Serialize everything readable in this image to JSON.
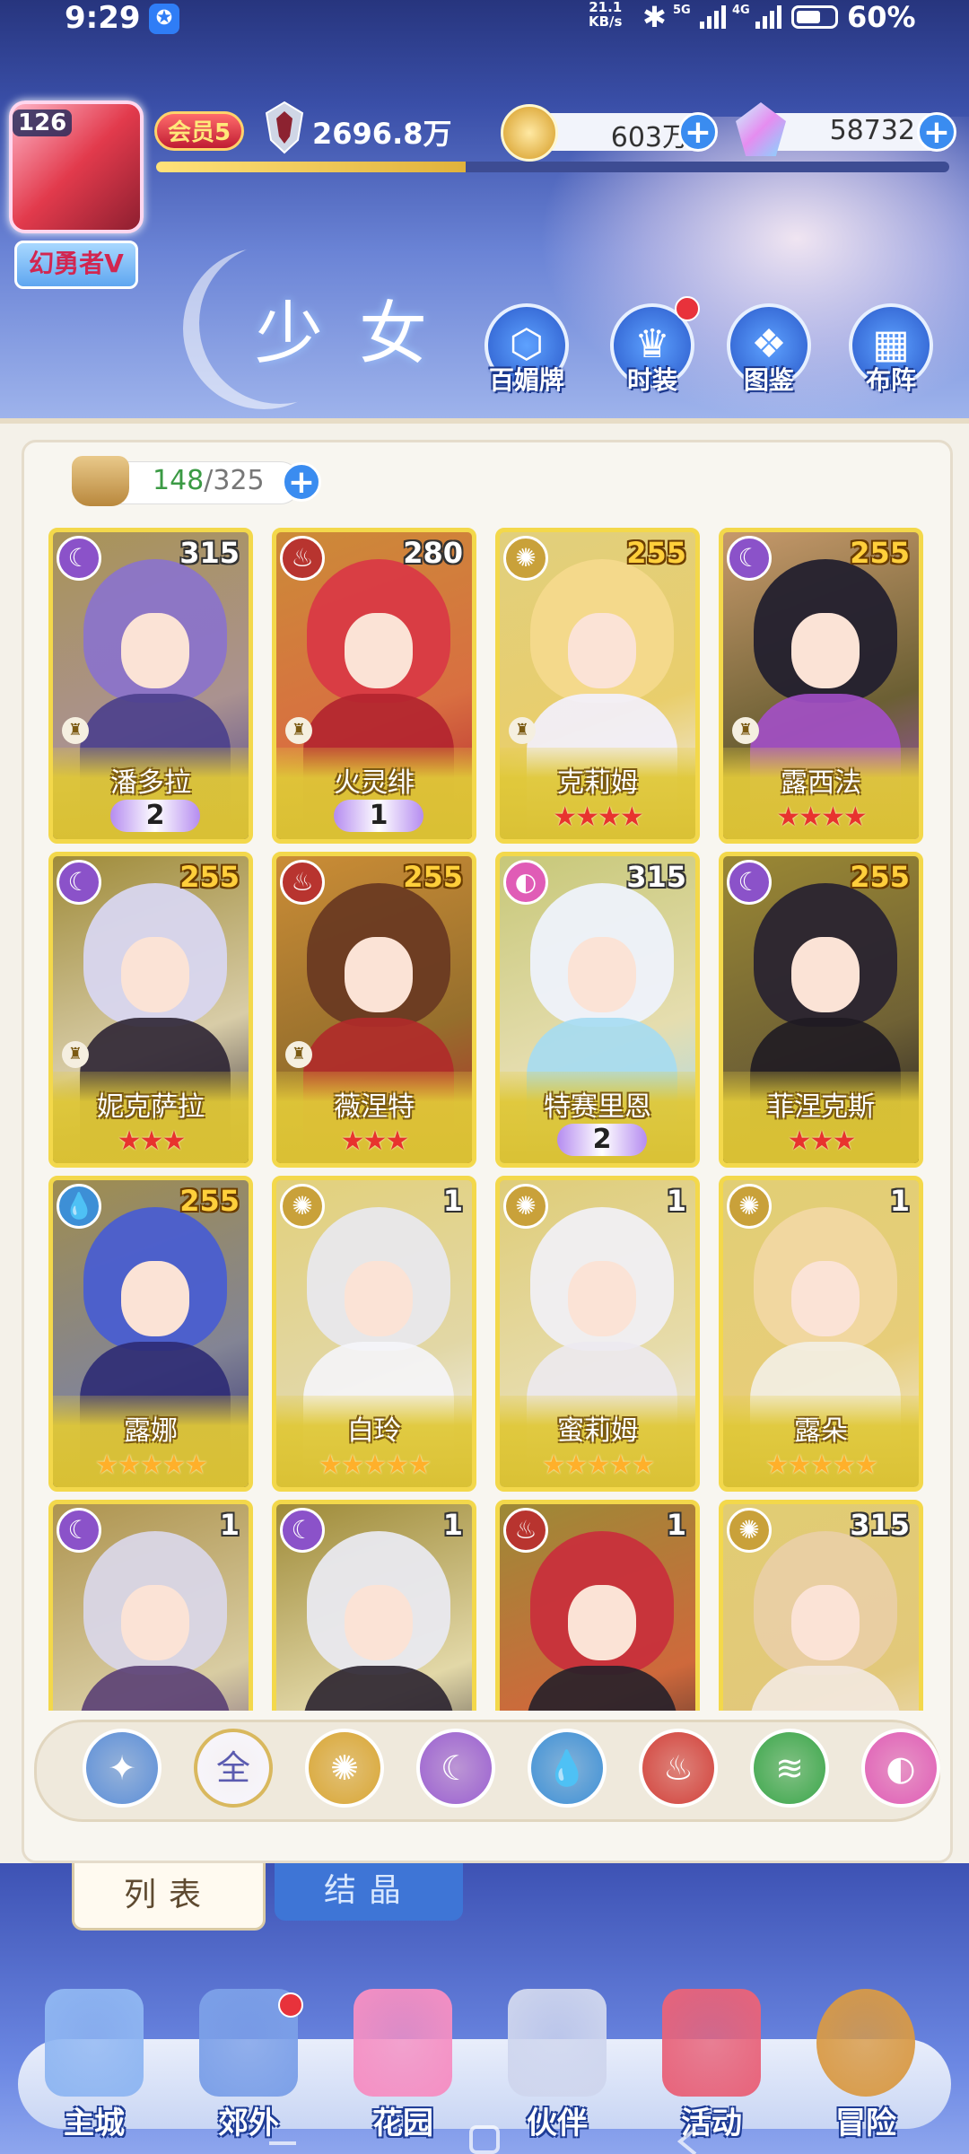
{
  "status": {
    "time": "9:29",
    "net_speed_top": "21.1",
    "net_speed_bottom": "KB/s",
    "sig1": "5G",
    "sig2": "4G",
    "battery": "60%"
  },
  "player": {
    "level": "126",
    "title": "幻勇者V",
    "vip": "会员5",
    "power": "2696.8万",
    "exp_fraction": 0.39
  },
  "currency": {
    "coins": "603万",
    "gems": "58732"
  },
  "header": {
    "title": "少女"
  },
  "top_nav": [
    {
      "label": "百媚牌",
      "icon": "card-icon",
      "badge": false
    },
    {
      "label": "时装",
      "icon": "outfit-icon",
      "badge": true
    },
    {
      "label": "图鉴",
      "icon": "book-icon",
      "badge": false
    },
    {
      "label": "布阵",
      "icon": "grid-icon",
      "badge": false
    }
  ],
  "inventory": {
    "count": "148",
    "capacity": "/325"
  },
  "cards": [
    {
      "name": "潘多拉",
      "level": "315",
      "level_gold": false,
      "element": "moon",
      "chess": true,
      "rank_type": "wing",
      "rank": "2",
      "hair": "#8b74c9",
      "body": "#4a3f8c"
    },
    {
      "name": "火灵绯",
      "level": "280",
      "level_gold": false,
      "element": "fire",
      "chess": true,
      "rank_type": "wing",
      "rank": "1",
      "hair": "#d93a44",
      "body": "#b3232f"
    },
    {
      "name": "克莉姆",
      "level": "255",
      "level_gold": true,
      "element": "sun",
      "chess": true,
      "rank_type": "red",
      "rank": "★★★★",
      "hair": "#f4d98c",
      "body": "#f3f1ff"
    },
    {
      "name": "露西法",
      "level": "255",
      "level_gold": true,
      "element": "moon",
      "chess": true,
      "rank_type": "red",
      "rank": "★★★★",
      "hair": "#23202e",
      "body": "#a34fc9"
    },
    {
      "name": "妮克萨拉",
      "level": "255",
      "level_gold": true,
      "element": "moon",
      "chess": true,
      "rank_type": "red",
      "rank": "★★★",
      "hair": "#d8d6ef",
      "body": "#2d2534"
    },
    {
      "name": "薇涅特",
      "level": "255",
      "level_gold": true,
      "element": "fire",
      "chess": true,
      "rank_type": "red",
      "rank": "★★★",
      "hair": "#6a3a22",
      "body": "#b02a2a"
    },
    {
      "name": "特赛里恩",
      "level": "315",
      "level_gold": false,
      "element": "pink",
      "chess": false,
      "rank_type": "wing",
      "rank": "2",
      "hair": "#eef2fb",
      "body": "#a5dbf2"
    },
    {
      "name": "菲涅克斯",
      "level": "255",
      "level_gold": true,
      "element": "moon",
      "chess": false,
      "rank_type": "red",
      "rank": "★★★",
      "hair": "#2a2430",
      "body": "#1f1b22"
    },
    {
      "name": "露娜",
      "level": "255",
      "level_gold": true,
      "element": "water",
      "chess": false,
      "rank_type": "gold",
      "rank": "★★★★★",
      "hair": "#4a5ed0",
      "body": "#2e2b74"
    },
    {
      "name": "白玲",
      "level": "1",
      "level_gold": false,
      "element": "sun",
      "chess": false,
      "rank_type": "gold",
      "rank": "★★★★★",
      "hair": "#e8e8ec",
      "body": "#f5f5fa"
    },
    {
      "name": "蜜莉姆",
      "level": "1",
      "level_gold": false,
      "element": "sun",
      "chess": false,
      "rank_type": "gold",
      "rank": "★★★★★",
      "hair": "#f0eff3",
      "body": "#ece9f0"
    },
    {
      "name": "露朵",
      "level": "1",
      "level_gold": false,
      "element": "sun",
      "chess": false,
      "rank_type": "gold",
      "rank": "★★★★★",
      "hair": "#f1d7a2",
      "body": "#f3efe6"
    },
    {
      "name": "",
      "level": "1",
      "level_gold": false,
      "element": "moon",
      "chess": false,
      "rank_type": "none",
      "rank": "",
      "hair": "#d9d6e6",
      "body": "#5a3f74"
    },
    {
      "name": "",
      "level": "1",
      "level_gold": false,
      "element": "moon",
      "chess": false,
      "rank_type": "none",
      "rank": "",
      "hair": "#e9e9ef",
      "body": "#2b2330"
    },
    {
      "name": "",
      "level": "1",
      "level_gold": false,
      "element": "fire",
      "chess": false,
      "rank_type": "none",
      "rank": "",
      "hair": "#c8303b",
      "body": "#26202a"
    },
    {
      "name": "",
      "level": "315",
      "level_gold": false,
      "element": "sun",
      "chess": false,
      "rank_type": "none",
      "rank": "",
      "hair": "#e9cfa4",
      "body": "#f3e9e0"
    }
  ],
  "filters": [
    {
      "name": "filter-all-roles",
      "label": "",
      "color": "#5b8ed8"
    },
    {
      "name": "filter-all",
      "label": "全",
      "color": "#f8f6ff"
    },
    {
      "name": "filter-sun",
      "label": "",
      "color": "#d9a634"
    },
    {
      "name": "filter-moon",
      "label": "",
      "color": "#9a5fd0"
    },
    {
      "name": "filter-water",
      "label": "",
      "color": "#3d8fd6"
    },
    {
      "name": "filter-fire",
      "label": "",
      "color": "#d2403a"
    },
    {
      "name": "filter-wind",
      "label": "",
      "color": "#3aa64a"
    },
    {
      "name": "filter-pink",
      "label": "",
      "color": "#e05cb6"
    }
  ],
  "tabs": {
    "list": "列表",
    "crystal": "结晶"
  },
  "bottom_nav": [
    {
      "label": "主城",
      "color": "#8fb6f2",
      "badge": false
    },
    {
      "label": "郊外",
      "color": "#7ca0e8",
      "badge": true
    },
    {
      "label": "花园",
      "color": "#f58fc3",
      "badge": false
    },
    {
      "label": "伙伴",
      "color": "#cfd6ee",
      "badge": false
    },
    {
      "label": "活动",
      "color": "#e8637a",
      "badge": false
    },
    {
      "label": "冒险",
      "color": "#d99a45",
      "badge": false
    }
  ],
  "element_icons": {
    "moon": "☾",
    "fire": "♨",
    "sun": "✺",
    "water": "💧",
    "pink": "◐",
    "wind": "≋"
  },
  "element_colors": {
    "moon": "#8b52c9",
    "fire": "#b8342f",
    "sun": "#c9a13a",
    "water": "#3d8fd6",
    "pink": "#e05cb6"
  }
}
